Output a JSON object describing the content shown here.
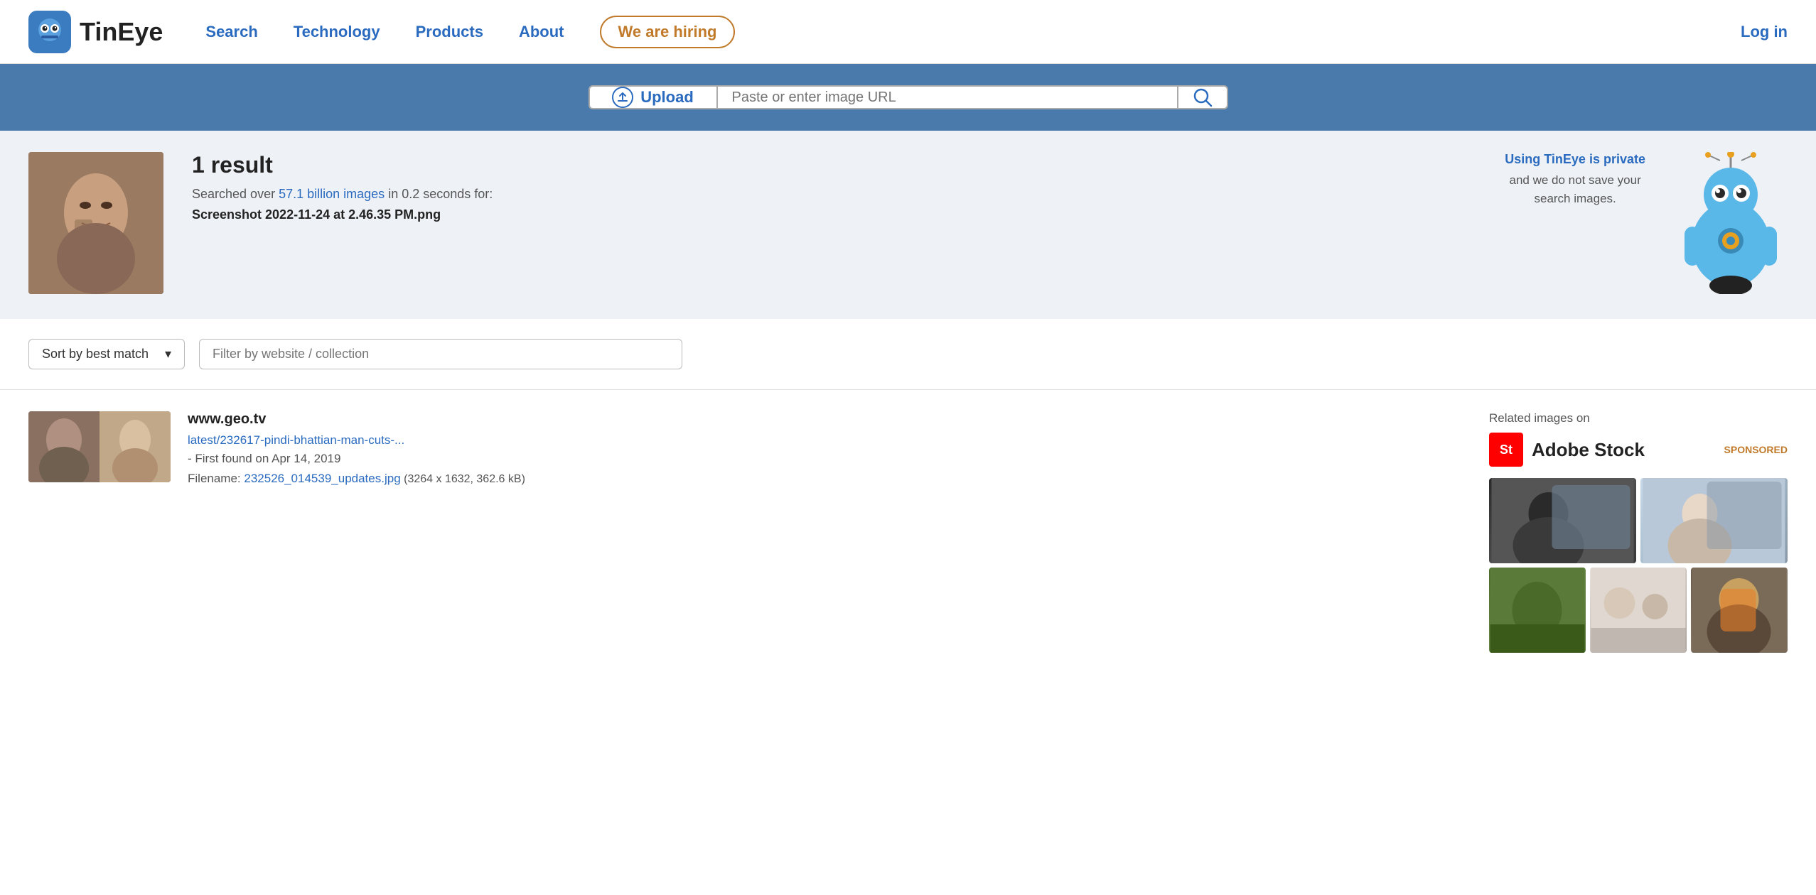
{
  "header": {
    "logo_text": "TinEye",
    "nav": {
      "search": "Search",
      "technology": "Technology",
      "products": "Products",
      "about": "About",
      "hiring": "We are hiring",
      "login": "Log in"
    }
  },
  "search": {
    "upload_label": "Upload",
    "url_placeholder": "Paste or enter image URL"
  },
  "results": {
    "count": "1 result",
    "meta_prefix": "Searched over",
    "meta_count": "57.1 billion images",
    "meta_suffix": "in 0.2 seconds for:",
    "filename": "Screenshot 2022-11-24 at 2.46.35 PM.png",
    "privacy_link": "Using TinEye is private",
    "privacy_text": "and we do not save your\nsearch images."
  },
  "filter": {
    "sort_label": "Sort by best match",
    "filter_placeholder": "Filter by website / collection"
  },
  "result_items": [
    {
      "domain": "www.geo.tv",
      "url": "latest/232617-pindi-bhattian-man-cuts-...",
      "found_text": "- First found on Apr 14, 2019",
      "filename_label": "Filename:",
      "filename": "232526_014539_updates.jpg",
      "fileinfo": "(3264 x 1632, 362.6 kB)"
    }
  ],
  "sidebar": {
    "related_label": "Related images on",
    "adobe_stock": "Adobe Stock",
    "adobe_st": "St",
    "sponsored": "SPONSORED"
  }
}
